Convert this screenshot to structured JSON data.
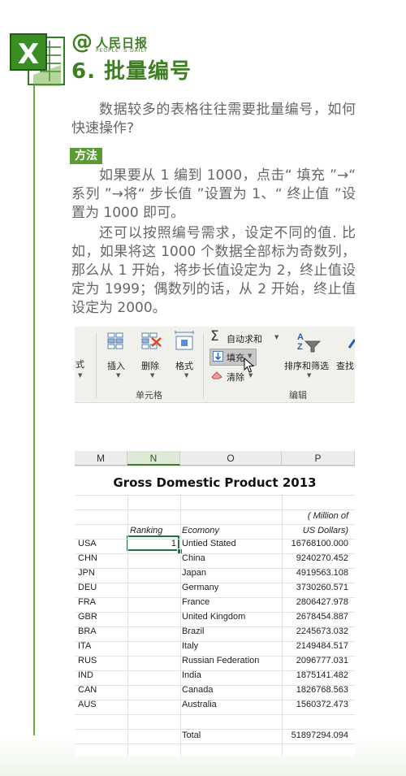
{
  "header": {
    "brand_at": "@",
    "brand_cn": "人民日报",
    "brand_en": "PEOPLE' S DAILY",
    "title": "6. 批量编号",
    "logo_icon": "excel-x-icon"
  },
  "content": {
    "intro": "数据较多的表格往往需要批量编号，如何快速操作?",
    "method_label": "方法",
    "method_text": "如果要从 1 编到 1000，点击“ 填充 ”→“ 系列 ”→将“ 步长值 ”设置为 1、“ 终止值 ”设置为 1000 即可。",
    "tip_text": "还可以按照编号需求，设定不同的值. 比如，如果将这 1000 个数据全部标为奇数列，那么从 1 开始，将步长值设定为 2，终止值设定为 1999；偶数列的话，从 2 开始，终止值设定为 2000。"
  },
  "ribbon": {
    "partial_format": "样式",
    "insert": "插入",
    "delete": "删除",
    "format": "格式",
    "cells_group": "单元格",
    "autosum": "自动求和",
    "fill": "填充",
    "clear": "清除",
    "sort_filter": "排序和筛选",
    "find": "查找",
    "editing_group": "编辑"
  },
  "sheet": {
    "columns": [
      "M",
      "N",
      "O",
      "P"
    ],
    "selected_column": "N",
    "title": "Gross Domestic Product 2013",
    "unit_line1": "( Million of",
    "unit_line2": "US Dollars)",
    "ranking_header": "Ranking",
    "economy_header": "Ecomony",
    "rows": [
      {
        "code": "USA",
        "rank": "1",
        "name": "Untied Stated",
        "gdp": "16768100.000"
      },
      {
        "code": "CHN",
        "rank": "",
        "name": "China",
        "gdp": "9240270.452"
      },
      {
        "code": "JPN",
        "rank": "",
        "name": "Japan",
        "gdp": "4919563.108"
      },
      {
        "code": "DEU",
        "rank": "",
        "name": "Germany",
        "gdp": "3730260.571"
      },
      {
        "code": "FRA",
        "rank": "",
        "name": "France",
        "gdp": "2806427.978"
      },
      {
        "code": "GBR",
        "rank": "",
        "name": "United Kingdom",
        "gdp": "2678454.887"
      },
      {
        "code": "BRA",
        "rank": "",
        "name": "Brazil",
        "gdp": "2245673.032"
      },
      {
        "code": "ITA",
        "rank": "",
        "name": "Italy",
        "gdp": "2149484.517"
      },
      {
        "code": "RUS",
        "rank": "",
        "name": "Russian Federation",
        "gdp": "2096777.031"
      },
      {
        "code": "IND",
        "rank": "",
        "name": "India",
        "gdp": "1875141.482"
      },
      {
        "code": "CAN",
        "rank": "",
        "name": "Canada",
        "gdp": "1826768.563"
      },
      {
        "code": "AUS",
        "rank": "",
        "name": "Australia",
        "gdp": "1560372.473"
      }
    ],
    "total_label": "Total",
    "total_value": "51897294.094"
  }
}
